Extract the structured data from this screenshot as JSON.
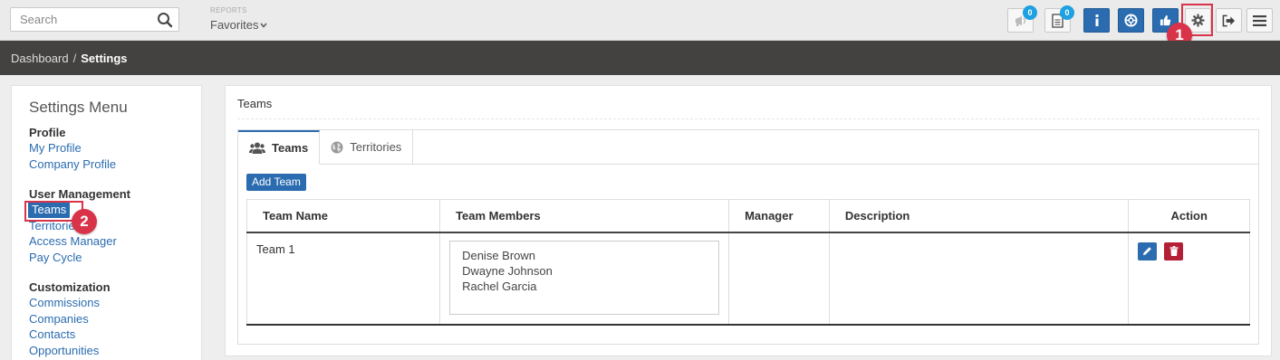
{
  "topbar": {
    "search_placeholder": "Search",
    "reports_label": "REPORTS",
    "favorites_label": "Favorites",
    "notifications_count": "0",
    "documents_count": "0"
  },
  "markers": {
    "one": "1",
    "two": "2"
  },
  "breadcrumb": {
    "home": "Dashboard",
    "separator": "/",
    "current": "Settings"
  },
  "sidebar": {
    "title": "Settings Menu",
    "groups": [
      {
        "heading": "Profile",
        "items": [
          "My Profile",
          "Company Profile"
        ]
      },
      {
        "heading": "User Management",
        "items": [
          "Teams",
          "Territories",
          "Access Manager",
          "Pay Cycle"
        ]
      },
      {
        "heading": "Customization",
        "items": [
          "Commissions",
          "Companies",
          "Contacts",
          "Opportunities"
        ]
      }
    ]
  },
  "main": {
    "title": "Teams",
    "tabs": [
      {
        "label": "Teams",
        "icon": "users-icon"
      },
      {
        "label": "Territories",
        "icon": "globe-icon"
      }
    ],
    "add_button": "Add Team",
    "table": {
      "headers": [
        "Team Name",
        "Team Members",
        "Manager",
        "Description",
        "Action"
      ],
      "rows": [
        {
          "team_name": "Team 1",
          "members": [
            "Denise Brown",
            "Dwayne Johnson",
            "Rachel Garcia"
          ],
          "manager": "",
          "description": ""
        }
      ]
    }
  },
  "colors": {
    "primary": "#2b6cb0",
    "danger": "#b51f36",
    "badge": "#1da1e0",
    "annotation": "#d9334a",
    "crumb_bar": "#444240"
  }
}
